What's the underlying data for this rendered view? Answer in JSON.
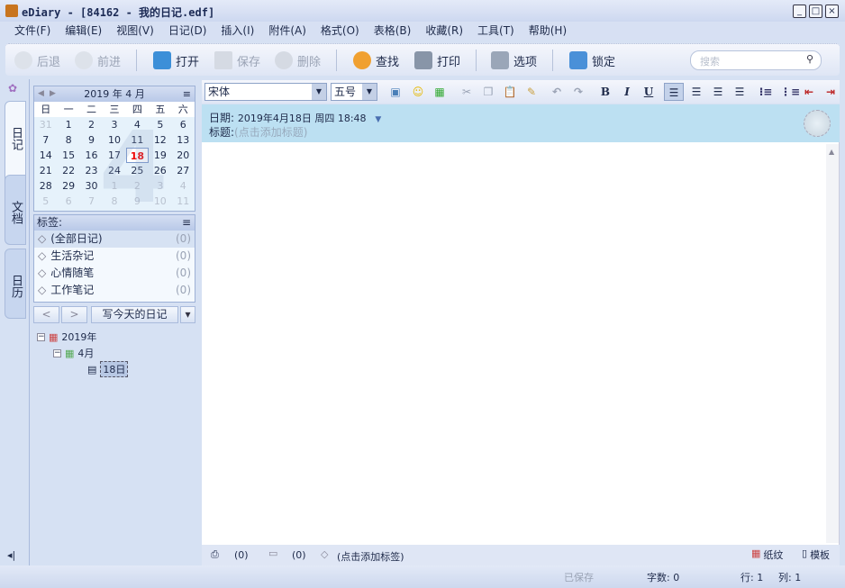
{
  "window": {
    "title": "eDiary - [84162 - 我的日记.edf]",
    "min": "_",
    "max": "□",
    "close": "×"
  },
  "menu": [
    "文件(F)",
    "编辑(E)",
    "视图(V)",
    "日记(D)",
    "插入(I)",
    "附件(A)",
    "格式(O)",
    "表格(B)",
    "收藏(R)",
    "工具(T)",
    "帮助(H)"
  ],
  "toolbar": {
    "back": "后退",
    "forward": "前进",
    "open": "打开",
    "save": "保存",
    "delete": "删除",
    "find": "查找",
    "print": "打印",
    "options": "选项",
    "lock": "锁定",
    "search_placeholder": "搜索"
  },
  "tabs": [
    "日记",
    "文档",
    "日历"
  ],
  "calendar": {
    "title": "2019 年 4 月",
    "watermark": "4",
    "weekdays": [
      "日",
      "一",
      "二",
      "三",
      "四",
      "五",
      "六"
    ],
    "rows": [
      [
        "31",
        "1",
        "2",
        "3",
        "4",
        "5",
        "6"
      ],
      [
        "7",
        "8",
        "9",
        "10",
        "11",
        "12",
        "13"
      ],
      [
        "14",
        "15",
        "16",
        "17",
        "18",
        "19",
        "20"
      ],
      [
        "21",
        "22",
        "23",
        "24",
        "25",
        "26",
        "27"
      ],
      [
        "28",
        "29",
        "30",
        "1",
        "2",
        "3",
        "4"
      ],
      [
        "5",
        "6",
        "7",
        "8",
        "9",
        "10",
        "11"
      ]
    ],
    "today": "18"
  },
  "tags": {
    "header": "标签:",
    "items": [
      {
        "label": "(全部日记)",
        "count": "(0)"
      },
      {
        "label": "生活杂记",
        "count": "(0)"
      },
      {
        "label": "心情随笔",
        "count": "(0)"
      },
      {
        "label": "工作笔记",
        "count": "(0)"
      }
    ]
  },
  "nav": {
    "prev": "<",
    "next": ">",
    "write_today": "写今天的日记",
    "menu": "▾"
  },
  "tree": {
    "year": "2019年",
    "month": "4月",
    "day": "18日"
  },
  "editor": {
    "font": "宋体",
    "size": "五号",
    "date_label": "日期:",
    "date_value": "2019年4月18日 周四 18:48",
    "title_label": "标题:",
    "title_placeholder": "(点击添加标题)"
  },
  "bottom": {
    "attach_count": "(0)",
    "comment_count": "(0)",
    "tag_placeholder": "(点击添加标签)",
    "paper": "纸纹",
    "template": "模板"
  },
  "status": {
    "saved": "已保存",
    "words": "字数: 0",
    "row": "行: 1",
    "col": "列: 1"
  }
}
